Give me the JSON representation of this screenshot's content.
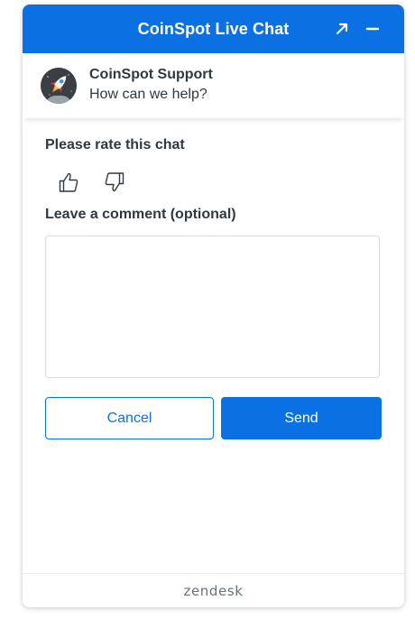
{
  "header": {
    "title": "CoinSpot Live Chat",
    "popout_icon": "popout-arrow-icon",
    "minimize_icon": "minimize-icon",
    "bg_color": "#0b71e3"
  },
  "agent": {
    "name": "CoinSpot Support",
    "subtitle": "How can we help?",
    "avatar_icon": "rocket-avatar"
  },
  "rating": {
    "label": "Please rate this chat",
    "up_icon": "thumbs-up-icon",
    "down_icon": "thumbs-down-icon"
  },
  "comment": {
    "label": "Leave a comment (optional)",
    "value": "",
    "placeholder": ""
  },
  "actions": {
    "cancel_label": "Cancel",
    "send_label": "Send"
  },
  "footer": {
    "brand": "zendesk"
  }
}
